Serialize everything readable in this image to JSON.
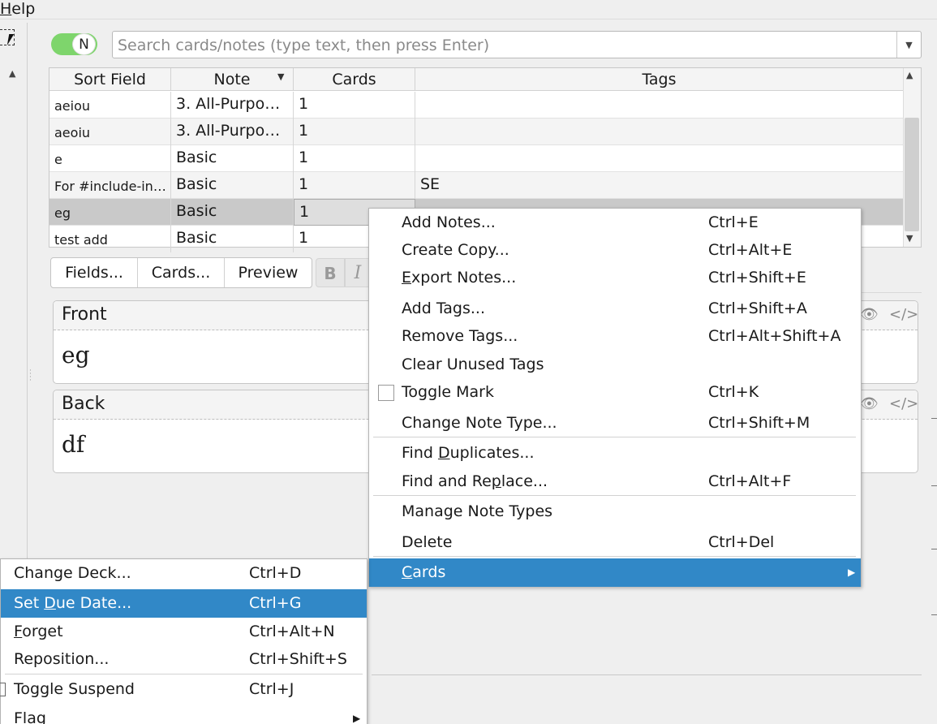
{
  "menubar": {
    "help_first": "H",
    "help_rest": "elp"
  },
  "toggle": {
    "label": "N"
  },
  "search": {
    "placeholder": "Search cards/notes (type text, then press Enter)"
  },
  "table": {
    "columns": [
      "Sort Field",
      "Note",
      "Cards",
      "Tags"
    ],
    "rows": [
      {
        "sort_field": "aeiou",
        "note": "3. All-Purpo…",
        "cards": "1",
        "tags": ""
      },
      {
        "sort_field": "aeoiu",
        "note": "3. All-Purpo…",
        "cards": "1",
        "tags": ""
      },
      {
        "sort_field": "e",
        "note": "Basic",
        "cards": "1",
        "tags": ""
      },
      {
        "sort_field": "For #include-in…",
        "note": "Basic",
        "cards": "1",
        "tags": "SE"
      },
      {
        "sort_field": "eg",
        "note": "Basic",
        "cards": "1",
        "tags": ""
      },
      {
        "sort_field": "test add",
        "note": "Basic",
        "cards": "1",
        "tags": ""
      }
    ],
    "selected_row": 4
  },
  "editor": {
    "tabs": [
      "Fields...",
      "Cards...",
      "Preview"
    ],
    "format": {
      "bold": "B",
      "italic": "I"
    },
    "fields": [
      {
        "label": "Front",
        "value": "eg"
      },
      {
        "label": "Back",
        "value": "df"
      }
    ]
  },
  "notes_menu": {
    "items": [
      {
        "label": "Add Notes...",
        "shortcut": "Ctrl+E"
      },
      {
        "label": "Create Copy...",
        "shortcut": "Ctrl+Alt+E"
      },
      {
        "label_u": "E",
        "label_rest": "xport Notes...",
        "shortcut": "Ctrl+Shift+E"
      },
      {
        "label": "Add Tags...",
        "shortcut": "Ctrl+Shift+A"
      },
      {
        "label": "Remove Tags...",
        "shortcut": "Ctrl+Alt+Shift+A"
      },
      {
        "label": "Clear Unused Tags",
        "shortcut": ""
      },
      {
        "label": "Toggle Mark",
        "shortcut": "Ctrl+K"
      },
      {
        "label": "Change Note Type...",
        "shortcut": "Ctrl+Shift+M"
      },
      {
        "label_pre": "Find ",
        "label_u": "D",
        "label_rest": "uplicates...",
        "shortcut": ""
      },
      {
        "label_pre": "Find and Re",
        "label_u": "p",
        "label_rest": "lace...",
        "shortcut": "Ctrl+Alt+F"
      },
      {
        "label": "Manage Note Types",
        "shortcut": ""
      },
      {
        "label": "Delete",
        "shortcut": "Ctrl+Del"
      },
      {
        "label_u": "C",
        "label_rest": "ards",
        "shortcut": ""
      }
    ]
  },
  "cards_menu": {
    "items": [
      {
        "label": "Change Deck...",
        "shortcut": "Ctrl+D"
      },
      {
        "label_pre": "Set ",
        "label_u": "D",
        "label_rest": "ue Date...",
        "shortcut": "Ctrl+G"
      },
      {
        "label_u": "F",
        "label_rest": "orget",
        "shortcut": "Ctrl+Alt+N"
      },
      {
        "label": "Reposition...",
        "shortcut": "Ctrl+Shift+S"
      },
      {
        "label": "Toggle Suspend",
        "shortcut": "Ctrl+J"
      },
      {
        "label": "Flag",
        "shortcut": ""
      }
    ]
  },
  "colors": {
    "highlight": "#3188c7",
    "toggle_on": "#7ed56c"
  },
  "icons": [
    "preview-eye-icon",
    "html-editor-icon",
    "submenu-arrow-icon",
    "dropdown-arrow-icon",
    "sort-arrow-icon",
    "checkbox-icon"
  ]
}
